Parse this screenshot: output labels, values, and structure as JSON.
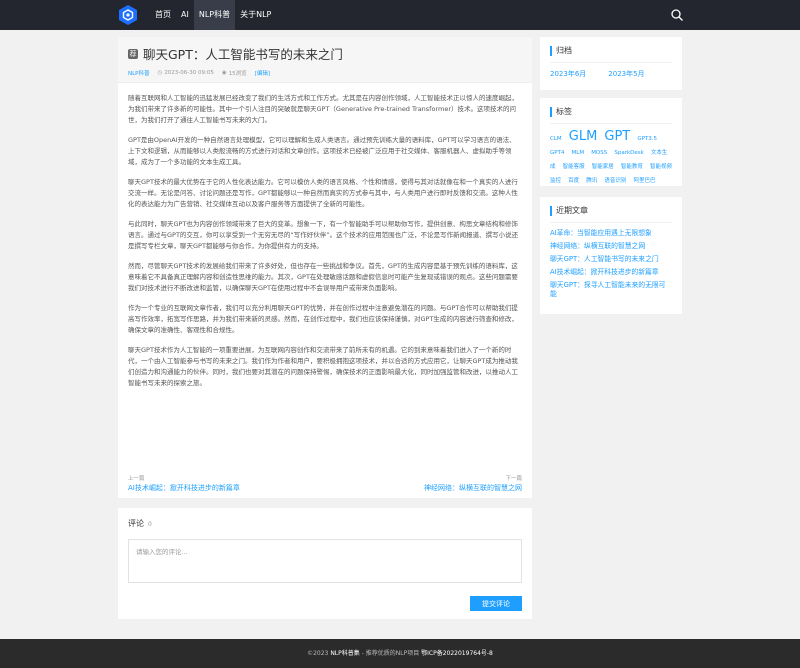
{
  "nav": {
    "items": [
      {
        "label": "首页",
        "active": false
      },
      {
        "label": "AI",
        "active": false
      },
      {
        "label": "NLP科普",
        "active": true
      },
      {
        "label": "关于NLP",
        "active": false
      }
    ]
  },
  "article": {
    "badge": "荐",
    "title": "聊天GPT：人工智能书写的未来之门",
    "category": "NLP科普",
    "date": "2023-06-30 09:05",
    "views": "15浏览",
    "edit": "[编辑]",
    "paragraphs": [
      "随着互联网和人工智能的迅猛发展已经改变了我们的生活方式和工作方式。尤其是在内容创作领域，人工智能技术正以惊人的速度崛起，为我们带来了许多新的可能性。其中一个引人注目的突破就是聊天GPT（Generative Pre-trained Transformer）技术。这项技术的问世，为我们打开了通往人工智能书写未来的大门。",
      "GPT是由OpenAI开发的一种自然语言处理模型，它可以理解和生成人类语言。通过预先训练大量的语料库，GPT可以学习语言的语法、上下文和逻辑，从而能够以人类般流畅的方式进行对话和文章创作。这项技术已经被广泛应用于社交媒体、客服机器人、虚拟助手等领域，成为了一个多功能的文本生成工具。",
      "聊天GPT技术的最大优势在于它的人性化表达能力。它可以模仿人类的语言风格、个性和情感，使得与其对话就像在和一个真实的人进行交流一样。无论是问答、讨论问题还是写作，GPT都能够以一种自然而真实的方式参与其中，与人类用户进行即时反馈和交流。这种人性化的表达能力为广告营销、社交媒体互动以及客户服务等方面提供了全新的可能性。",
      "与此同时，聊天GPT也为内容创作领域带来了巨大的变革。想象一下，有一个智能助手可以帮助你写作，提供创意、构思文章结构和修饰语言。通过与GPT的交互，你可以享受到一个无穷无尽的“写作好伙伴”。这个技术的应用范围也广泛，不论是写作新闻报道、撰写小说还是撰写专栏文章，聊天GPT都能够与你合作，为你提供有力的支持。",
      "然而，尽管聊天GPT技术的发展给我们带来了许多好处，但也存在一些挑战和争议。首先，GPT的生成内容是基于预先训练的语料库，这意味着它不具备真正理解内容和创造性思维的能力。其次，GPT在处理敏感话题和虚假信息时可能产生复现或错误的观点。这些问题需要我们对技术进行不断改进和监管，以确保聊天GPT在使用过程中不会误导用户或带来负面影响。",
      "作为一个专业的互联网文章作者，我们可以充分利用聊天GPT的优势，并在创作过程中注意避免潜在的问题。与GPT合作可以帮助我们提高写作效率，拓宽写作思路，并为我们带来新的灵感。然而，在创作过程中，我们也应该保持谨慎，对GPT生成的内容进行筛查和修改，确保文章的准确性、客观性和合规性。",
      "聊天GPT技术作为人工智能的一项重要进展，为互联网内容创作和交流带来了前所未有的机遇。它的到来意味着我们进入了一个新的时代，一个由人工智能参与书写的未来之门。我们作为作者和用户，要积极拥抱这项技术，并以合适的方式应用它，让聊天GPT成为推动我们创造力和沟通能力的伙伴。同时，我们也要对其潜在的问题保持警惕，确保技术的正面影响最大化，同时加强监管和改进，以推动人工智能书写未来的探索之旅。"
    ],
    "prev": {
      "label": "上一篇",
      "title": "AI技术崛起：掀开科技进步的新篇章"
    },
    "next": {
      "label": "下一篇",
      "title": "神经网络：纵横互联的智慧之网"
    }
  },
  "comments": {
    "title": "评论",
    "count": "0",
    "placeholder": "请输入您的评论...",
    "submit": "提交评论"
  },
  "sidebar": {
    "archive": {
      "title": "归档",
      "items": [
        "2023年6月",
        "2023年5月"
      ]
    },
    "tags": {
      "title": "标签",
      "items": [
        {
          "label": "CLM",
          "size": 5.5
        },
        {
          "label": "GLM",
          "size": 13
        },
        {
          "label": "GPT",
          "size": 13
        },
        {
          "label": "GPT3.5",
          "size": 5.5
        },
        {
          "label": "GPT4",
          "size": 5.5
        },
        {
          "label": "MLM",
          "size": 5.5
        },
        {
          "label": "MOSS",
          "size": 5.5
        },
        {
          "label": "SparkDesk",
          "size": 5.5
        },
        {
          "label": "文本生成",
          "size": 5.5
        },
        {
          "label": "智能客服",
          "size": 5.5
        },
        {
          "label": "智能家居",
          "size": 5.5
        },
        {
          "label": "智能教育",
          "size": 5.5
        },
        {
          "label": "智能视频监控",
          "size": 5.5
        },
        {
          "label": "百度",
          "size": 5.5
        },
        {
          "label": "腾讯",
          "size": 5.5
        },
        {
          "label": "语音识别",
          "size": 5.5
        },
        {
          "label": "阿里巴巴",
          "size": 5.5
        }
      ]
    },
    "recent": {
      "title": "近期文章",
      "items": [
        "AI革命：当智能应用遇上无限想象",
        "神经网络：纵横互联的智慧之网",
        "聊天GPT：人工智能书写的未来之门",
        "AI技术崛起：掀开科技进步的新篇章",
        "聊天GPT：探寻人工智能未来的无限可能"
      ]
    }
  },
  "footer": {
    "copyright": "©2023",
    "site": "NLP科普集",
    "slogan": "- 推荐优质的NLP项目",
    "icp": "鄂ICP备2022019764号-8"
  },
  "colors": {
    "accent": "#1e9fff",
    "topbar": "#23262e",
    "footer": "#2b2b2b"
  }
}
